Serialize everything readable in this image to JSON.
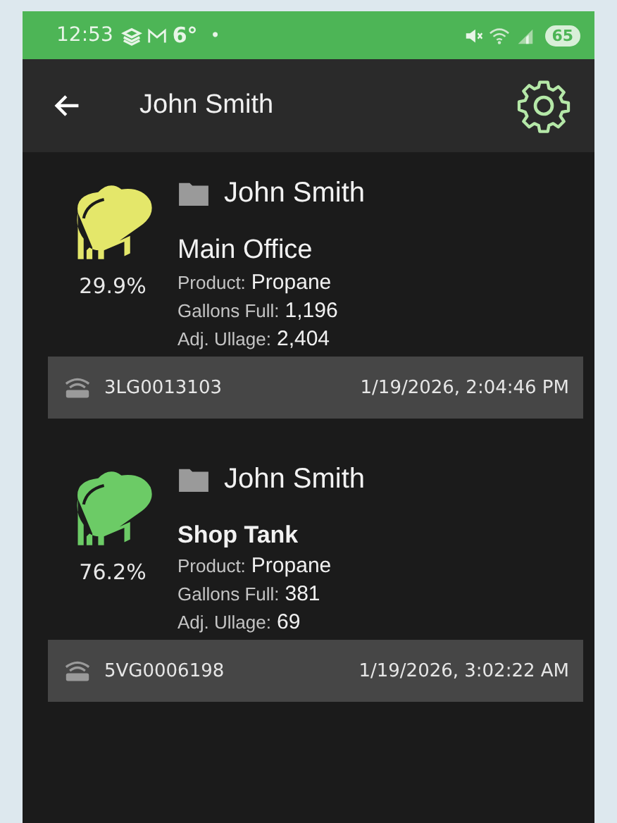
{
  "status_bar": {
    "time": "12:53",
    "temperature": "6°",
    "dot": "•",
    "battery": "65"
  },
  "app_bar": {
    "title": "John Smith"
  },
  "tanks": [
    {
      "color": "#e4e76a",
      "percent": "29.9%",
      "customer": "John Smith",
      "name": "Main Office",
      "emphasized": false,
      "details": [
        {
          "label": "Product:",
          "value": "Propane"
        },
        {
          "label": "Gallons Full:",
          "value": "1,196"
        },
        {
          "label": "Adj. Ullage:",
          "value": "2,404"
        }
      ],
      "device_id": "3LG0013103",
      "timestamp": "1/19/2026, 2:04:46 PM"
    },
    {
      "color": "#6ccb66",
      "percent": "76.2%",
      "customer": "John Smith",
      "name": "Shop Tank",
      "emphasized": true,
      "details": [
        {
          "label": "Product:",
          "value": "Propane"
        },
        {
          "label": "Gallons Full:",
          "value": "381"
        },
        {
          "label": "Adj. Ullage:",
          "value": "69"
        }
      ],
      "device_id": "5VG0006198",
      "timestamp": "1/19/2026, 3:02:22 AM"
    }
  ]
}
